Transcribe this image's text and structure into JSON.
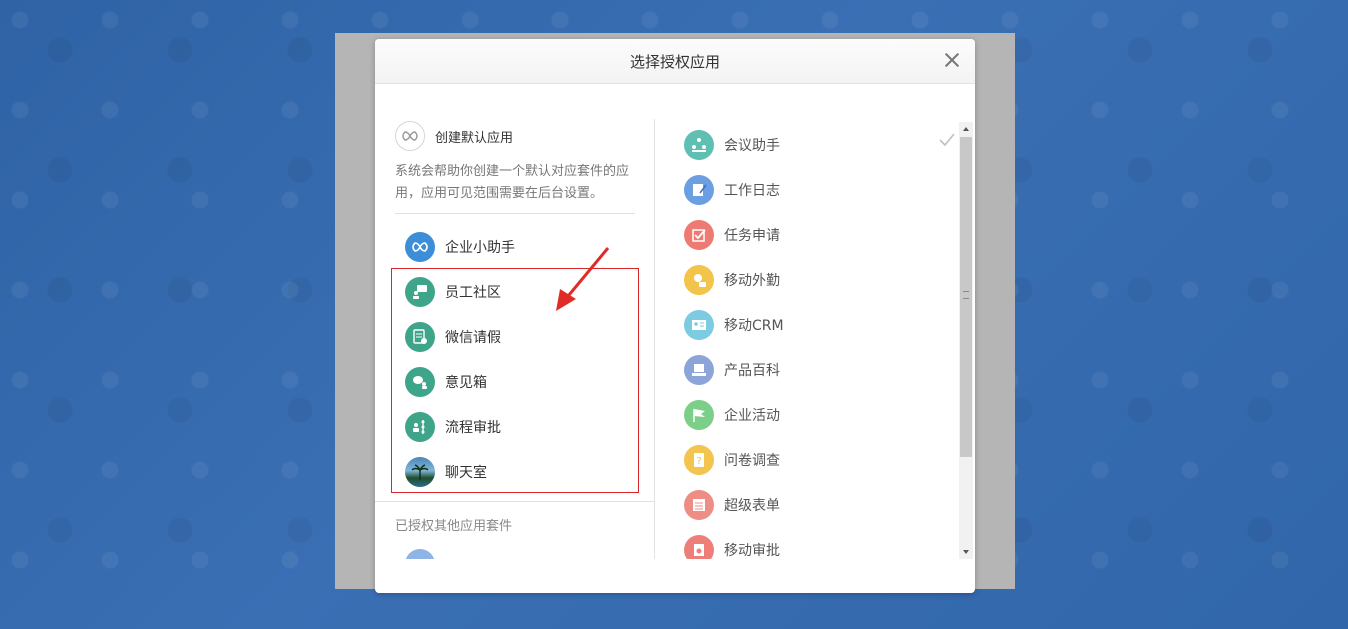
{
  "dialog": {
    "title": "选择授权应用"
  },
  "default_app": {
    "label": "创建默认应用",
    "description": "系统会帮助你创建一个默认对应套件的应用，应用可见范围需要在后台设置。",
    "icon": "infinity-icon"
  },
  "left_apps": [
    {
      "label": "企业小助手",
      "icon": "infinity-icon",
      "color": "#3d8ed8"
    },
    {
      "label": "员工社区",
      "icon": "community-icon",
      "color": "#3fa58a"
    },
    {
      "label": "微信请假",
      "icon": "leave-form-icon",
      "color": "#3fa58a"
    },
    {
      "label": "意见箱",
      "icon": "feedback-icon",
      "color": "#3fa58a"
    },
    {
      "label": "流程审批",
      "icon": "workflow-icon",
      "color": "#3fa58a"
    },
    {
      "label": "聊天室",
      "icon": "palm-tree-photo-icon",
      "color": "#2d5f84"
    }
  ],
  "other_suites_title": "已授权其他应用套件",
  "right_apps": [
    {
      "label": "会议助手",
      "icon": "meeting-icon",
      "color": "#5fbfb3"
    },
    {
      "label": "工作日志",
      "icon": "log-icon",
      "color": "#6c9ee2"
    },
    {
      "label": "任务申请",
      "icon": "task-check-icon",
      "color": "#ee7a74"
    },
    {
      "label": "移动外勤",
      "icon": "location-icon",
      "color": "#f2c44a"
    },
    {
      "label": "移动CRM",
      "icon": "crm-card-icon",
      "color": "#7dcbe0"
    },
    {
      "label": "产品百科",
      "icon": "product-icon",
      "color": "#8da4d8"
    },
    {
      "label": "企业活动",
      "icon": "flag-icon",
      "color": "#7ccf89"
    },
    {
      "label": "问卷调查",
      "icon": "questionnaire-icon",
      "color": "#f4c54e"
    },
    {
      "label": "超级表单",
      "icon": "form-icon",
      "color": "#ee8d86"
    },
    {
      "label": "移动审批",
      "icon": "approval-icon",
      "color": "#ee7f78"
    }
  ]
}
